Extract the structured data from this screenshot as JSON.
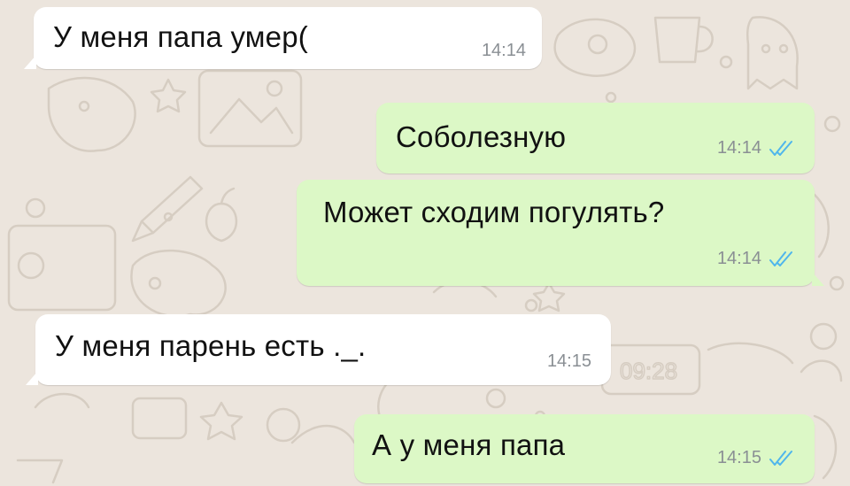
{
  "colors": {
    "wallpaper": "#ece5dd",
    "incoming_bubble": "#ffffff",
    "outgoing_bubble": "#dcf8c6",
    "read_receipt": "#4fb6ec",
    "timestamp": "#8a8f94"
  },
  "messages": [
    {
      "direction": "incoming",
      "text": "У меня папа умер(",
      "time": "14:14"
    },
    {
      "direction": "outgoing",
      "text": "Соболезную",
      "time": "14:14",
      "status_icon": "double-check-read-icon"
    },
    {
      "direction": "outgoing",
      "text": "Может сходим погулять?",
      "time": "14:14",
      "status_icon": "double-check-read-icon"
    },
    {
      "direction": "incoming",
      "text": "У меня парень есть ._.",
      "time": "14:15"
    },
    {
      "direction": "outgoing",
      "text": "А у меня папа",
      "time": "14:15",
      "status_icon": "double-check-read-icon"
    }
  ]
}
